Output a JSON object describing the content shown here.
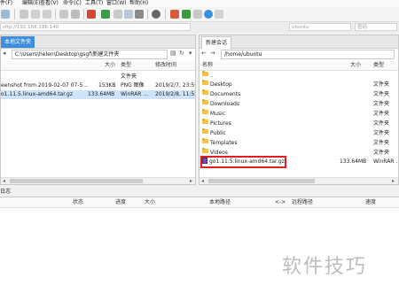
{
  "menu": {
    "items": [
      "件(F)",
      "编辑(E)",
      "查看(V)",
      "命令(C)",
      "工具(T)",
      "窗口(W)",
      "帮助(H)"
    ]
  },
  "quick_connect": {
    "host": "sftp://192.168.188.140",
    "user": "ubuntu",
    "password_placeholder": "密码"
  },
  "left_panel": {
    "tab_label": "本地文件夹",
    "path": "C:\\Users\\helen\\Desktop\\gsgf\\新建文件夹",
    "columns": {
      "name": "",
      "size": "大小",
      "type": "类型",
      "modified": "修改时间"
    },
    "files": [
      {
        "name": "..",
        "size": "",
        "type": "文件夹",
        "modified": ""
      },
      {
        "name": "eenshot from 2019-02-07 07-5...",
        "size": "153KB",
        "type": "PNG 图像",
        "modified": "2019/2/7, 23:59"
      },
      {
        "name": "o1.11.5.linux-amd64.tar.gz",
        "size": "133.64MB",
        "type": "WinRAR ...",
        "modified": "2019/2/8, 11:52"
      }
    ]
  },
  "right_panel": {
    "tab_label": "新建会话",
    "path": "/home/ubuntu",
    "columns": {
      "name": "名称",
      "size": "大小",
      "type": "类型"
    },
    "files": [
      {
        "name": "..",
        "size": "",
        "type": ""
      },
      {
        "name": "Desktop",
        "size": "",
        "type": "文件夹"
      },
      {
        "name": "Documents",
        "size": "",
        "type": "文件夹"
      },
      {
        "name": "Downloads",
        "size": "",
        "type": "文件夹"
      },
      {
        "name": "Music",
        "size": "",
        "type": "文件夹"
      },
      {
        "name": "Pictures",
        "size": "",
        "type": "文件夹"
      },
      {
        "name": "Public",
        "size": "",
        "type": "文件夹"
      },
      {
        "name": "Templates",
        "size": "",
        "type": "文件夹"
      },
      {
        "name": "Videos",
        "size": "",
        "type": "文件夹"
      },
      {
        "name": "go1.11.5.linux-amd64.tar.gz",
        "size": "133.64MB",
        "type": "WinRAR ..."
      }
    ]
  },
  "log": {
    "title": "日志",
    "columns": {
      "status": "状态",
      "progress": "进度",
      "size": "大小",
      "local": "本地路径",
      "dir": "<->",
      "remote": "远程路径",
      "speed": "速度"
    }
  },
  "watermark": "软件技巧",
  "colors": {
    "tab_active": "#3c8fde",
    "selected_row": "#cfe4fb",
    "folder": "#f3c24a",
    "highlight_box": "#e0201c"
  }
}
